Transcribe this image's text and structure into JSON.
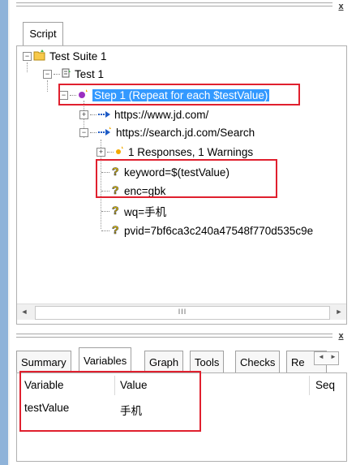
{
  "top_pane": {
    "close_label": "x"
  },
  "script_tab": {
    "label": "Script"
  },
  "tree": {
    "suite": "Test Suite 1",
    "test": "Test 1",
    "step": "Step 1 (Repeat for each $testValue)",
    "url1": "https://www.jd.com/",
    "url2": "https://search.jd.com/Search",
    "responses": "1 Responses, 1 Warnings",
    "params": [
      "keyword=$(testValue)",
      "enc=gbk",
      "wq=手机",
      "pvid=7bf6ca3c240a47548f770d535c9e"
    ]
  },
  "scrollbar": {
    "left_arrow": "◄",
    "right_arrow": "►",
    "thumb_grip": "III"
  },
  "bottom_pane": {
    "close_label": "x",
    "tabs": [
      "Summary",
      "Variables",
      "Graph",
      "Tools",
      "Checks",
      "Re"
    ],
    "active_tab": "Variables",
    "nav_left": "◄",
    "nav_right": "►",
    "columns": [
      "Variable",
      "Value",
      "Seq"
    ],
    "rows": [
      {
        "variable": "testValue",
        "value": "手机",
        "seq": ""
      }
    ]
  },
  "colors": {
    "selection": "#3399ff",
    "highlight_box": "#e0202e",
    "accent_strip": "#8fb3d9"
  }
}
